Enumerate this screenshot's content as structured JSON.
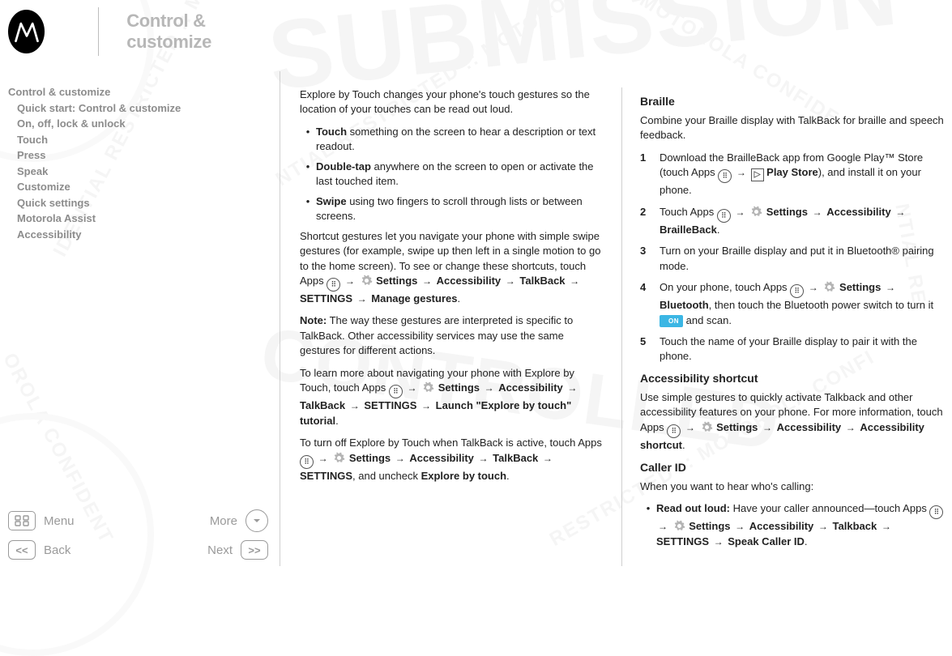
{
  "header": {
    "title": "Control & customize"
  },
  "nav": {
    "root": "Control & customize",
    "items": [
      "Quick start: Control & customize",
      "On, off, lock & unlock",
      "Touch",
      "Press",
      "Speak",
      "Customize",
      "Quick settings",
      "Motorola Assist",
      "Accessibility"
    ]
  },
  "bottom": {
    "menu": "Menu",
    "more": "More",
    "back": "Back",
    "next": "Next"
  },
  "glyph": {
    "arrow": "→",
    "apps_dots": "⠿",
    "play_tri": "▶",
    "on": "ON",
    "bullet": "•"
  },
  "left_col": {
    "intro": "Explore by Touch changes your phone's touch gestures so the location of your touches can be read out loud.",
    "b1_label": "Touch",
    "b1_rest": " something on the screen to hear a description or text readout.",
    "b2_label": "Double-tap",
    "b2_rest": " anywhere on the screen to open or activate the last touched item.",
    "b3_label": "Swipe",
    "b3_rest": " using two fingers to scroll through lists or between screens.",
    "p2a": "Shortcut gestures let you navigate your phone with simple swipe gestures (for example, swipe up then left in a single motion to go to the home screen). To see or change these shortcuts, touch Apps ",
    "p2_settings": " Settings",
    "p2_acc": "Accessibility",
    "p2_tb": "TalkBack",
    "p2_set2": "SETTINGS",
    "p2_mg": "Manage gestures",
    "note_label": "Note:",
    "note_rest": " The way these gestures are interpreted is specific to TalkBack. Other accessibility services may use the same gestures for different actions.",
    "p3a": "To learn more about navigating your phone with Explore by Touch, touch Apps ",
    "p3_launch": "Launch \"Explore by touch\" tutorial",
    "p4a": "To turn off Explore by Touch when TalkBack is active, touch Apps ",
    "p4_uncheck": ", and uncheck ",
    "p4_ebt": "Explore by touch"
  },
  "right_col": {
    "h_braille": "Braille",
    "braille_intro": "Combine your Braille display with TalkBack for braille and speech feedback.",
    "s1a": "Download the BrailleBack app from Google Play™ Store (touch Apps ",
    "s1_play": " Play Store",
    "s1b": "), and install it on your phone.",
    "s2a": "Touch Apps ",
    "s2_settings": " Settings",
    "s2_acc": "Accessibility",
    "s2_bb": "BrailleBack",
    "s3": "Turn on your Braille display and put it in Bluetooth® pairing mode.",
    "s4a": "On your phone, touch Apps ",
    "s4_settings": " Settings",
    "s4_bt": "Bluetooth",
    "s4b": ", then touch the Bluetooth power switch to turn it ",
    "s4c": " and scan.",
    "s5": "Touch the name of your Braille display to pair it with the phone.",
    "h_shortcut": "Accessibility shortcut",
    "shortcut_a": "Use simple gestures to quickly activate Talkback and other accessibility features on your phone. For more information, touch Apps ",
    "shortcut_acc2": "Accessibility shortcut",
    "h_caller": "Caller ID",
    "caller_intro": "When you want to hear who's calling:",
    "caller_b_label": "Read out loud:",
    "caller_b_rest": " Have your caller announced—touch Apps ",
    "caller_tb": "Talkback",
    "caller_speak": "Speak Caller ID"
  },
  "nums": {
    "n1": "1",
    "n2": "2",
    "n3": "3",
    "n4": "4",
    "n5": "5"
  },
  "period": "."
}
